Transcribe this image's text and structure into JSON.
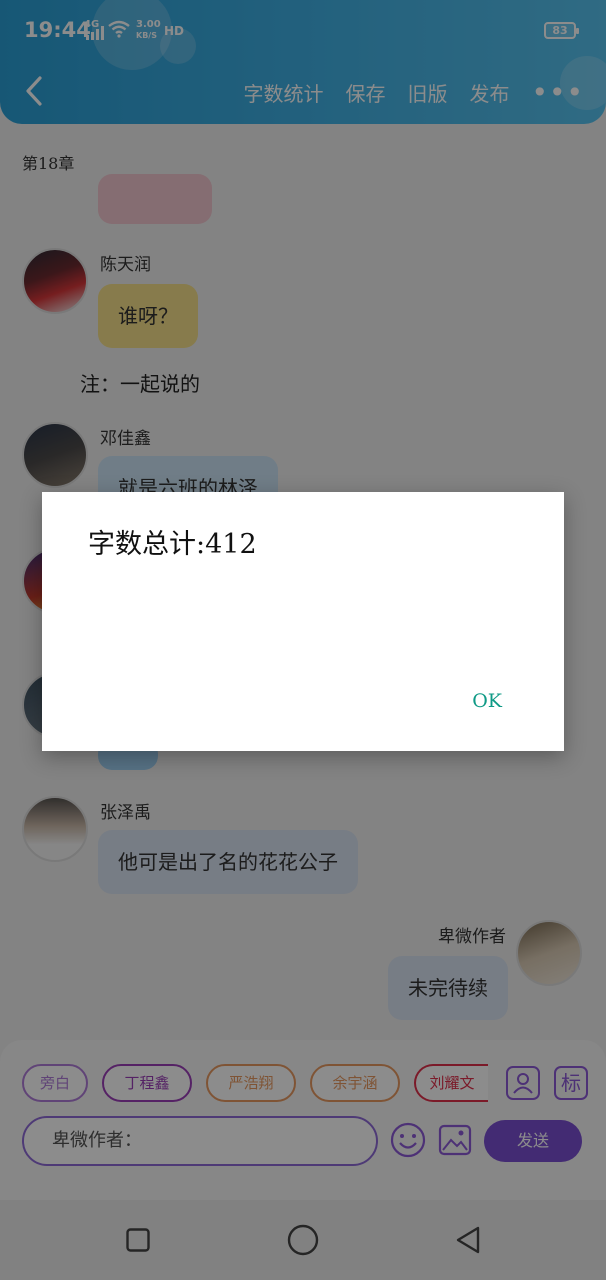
{
  "status_bar": {
    "time": "19:44",
    "network": "4G",
    "speed_value": "3.00",
    "speed_unit": "KB/S",
    "hd": "HD",
    "battery": "83"
  },
  "header": {
    "actions": [
      "字数统计",
      "保存",
      "旧版",
      "发布"
    ],
    "more": "•••",
    "accent": "#2da3d9"
  },
  "chapter": {
    "title": "第18章"
  },
  "messages": [
    {
      "name": "陈天润",
      "text": "谁呀？",
      "color": "#f6e08a"
    },
    {
      "name": "邓佳鑫",
      "text": "就是六班的林泽",
      "color": "#cde4f6"
    },
    {
      "name": "张泽禹",
      "text": "他可是出了名的花花公子",
      "color": "#d9e3f2"
    },
    {
      "name": "卑微作者",
      "text": "未完待续",
      "color": "#d9e3f2"
    }
  ],
  "note": "注：一起说的",
  "roles": [
    "旁白",
    "丁程鑫",
    "严浩翔",
    "余宇涵",
    "刘耀文"
  ],
  "input": {
    "placeholder": "卑微作者："
  },
  "send_label": "发送",
  "side_icons": {
    "role": "person-icon",
    "mark": "标"
  },
  "dialog": {
    "message": "字数总计:412",
    "ok_label": "OK"
  }
}
